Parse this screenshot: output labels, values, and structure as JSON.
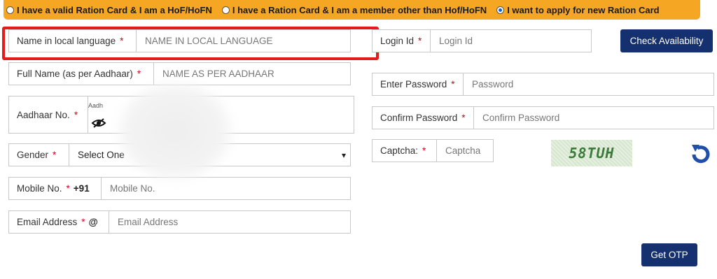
{
  "radio_options": [
    {
      "label": "I have a valid Ration Card & I am a HoF/HoFN",
      "checked": false
    },
    {
      "label": "I have a Ration Card & I am a member other than Hof/HoFN",
      "checked": false
    },
    {
      "label": "I want to apply for new Ration Card",
      "checked": true
    }
  ],
  "left_form": {
    "local_name": {
      "label": "Name in local language",
      "required": "*",
      "placeholder": "NAME IN LOCAL LANGUAGE"
    },
    "full_name": {
      "label": "Full Name (as per Aadhaar)",
      "required": "*",
      "placeholder": "NAME AS PER AADHAAR"
    },
    "aadhaar": {
      "label": "Aadhaar No.",
      "required": "*",
      "placeholder": "Aadh"
    },
    "gender": {
      "label": "Gender",
      "required": "*",
      "selected": "Select One"
    },
    "mobile": {
      "label": "Mobile No.",
      "required": "*",
      "prefix": "+91",
      "placeholder": "Mobile No."
    },
    "email": {
      "label": "Email Address",
      "required": "*",
      "prefix": "@",
      "placeholder": "Email Address"
    }
  },
  "right_form": {
    "login_id": {
      "label": "Login Id",
      "required": "*",
      "placeholder": "Login Id"
    },
    "check_button": "Check Availability",
    "password": {
      "label": "Enter Password",
      "required": "*",
      "placeholder": "Password"
    },
    "confirm_password": {
      "label": "Confirm Password",
      "required": "*",
      "placeholder": "Confirm Password"
    },
    "captcha": {
      "label": "Captcha:",
      "required": "*",
      "placeholder": "Captcha",
      "image_text": "58TUH"
    },
    "otp_button": "Get OTP"
  },
  "colors": {
    "radio_bar": "#f5a623",
    "button": "#15306e",
    "required": "#d0021b",
    "highlight": "#e31b1b"
  },
  "icons": {
    "eye": "eye-slash-icon",
    "refresh": "refresh-icon"
  }
}
